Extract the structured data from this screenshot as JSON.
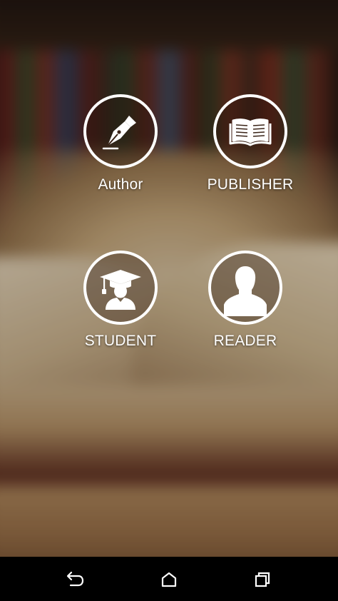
{
  "roles": {
    "author": {
      "label": "Author",
      "icon": "fountain-pen-icon"
    },
    "publisher": {
      "label": "PUBLISHER",
      "icon": "open-book-icon"
    },
    "student": {
      "label": "STUDENT",
      "icon": "graduate-icon"
    },
    "reader": {
      "label": "READER",
      "icon": "person-silhouette-icon"
    }
  },
  "navbar": {
    "back_icon": "back-icon",
    "home_icon": "home-icon",
    "recents_icon": "recents-icon"
  },
  "colors": {
    "ring": "#ffffff",
    "label": "#ffffff",
    "navbar": "#000000"
  }
}
